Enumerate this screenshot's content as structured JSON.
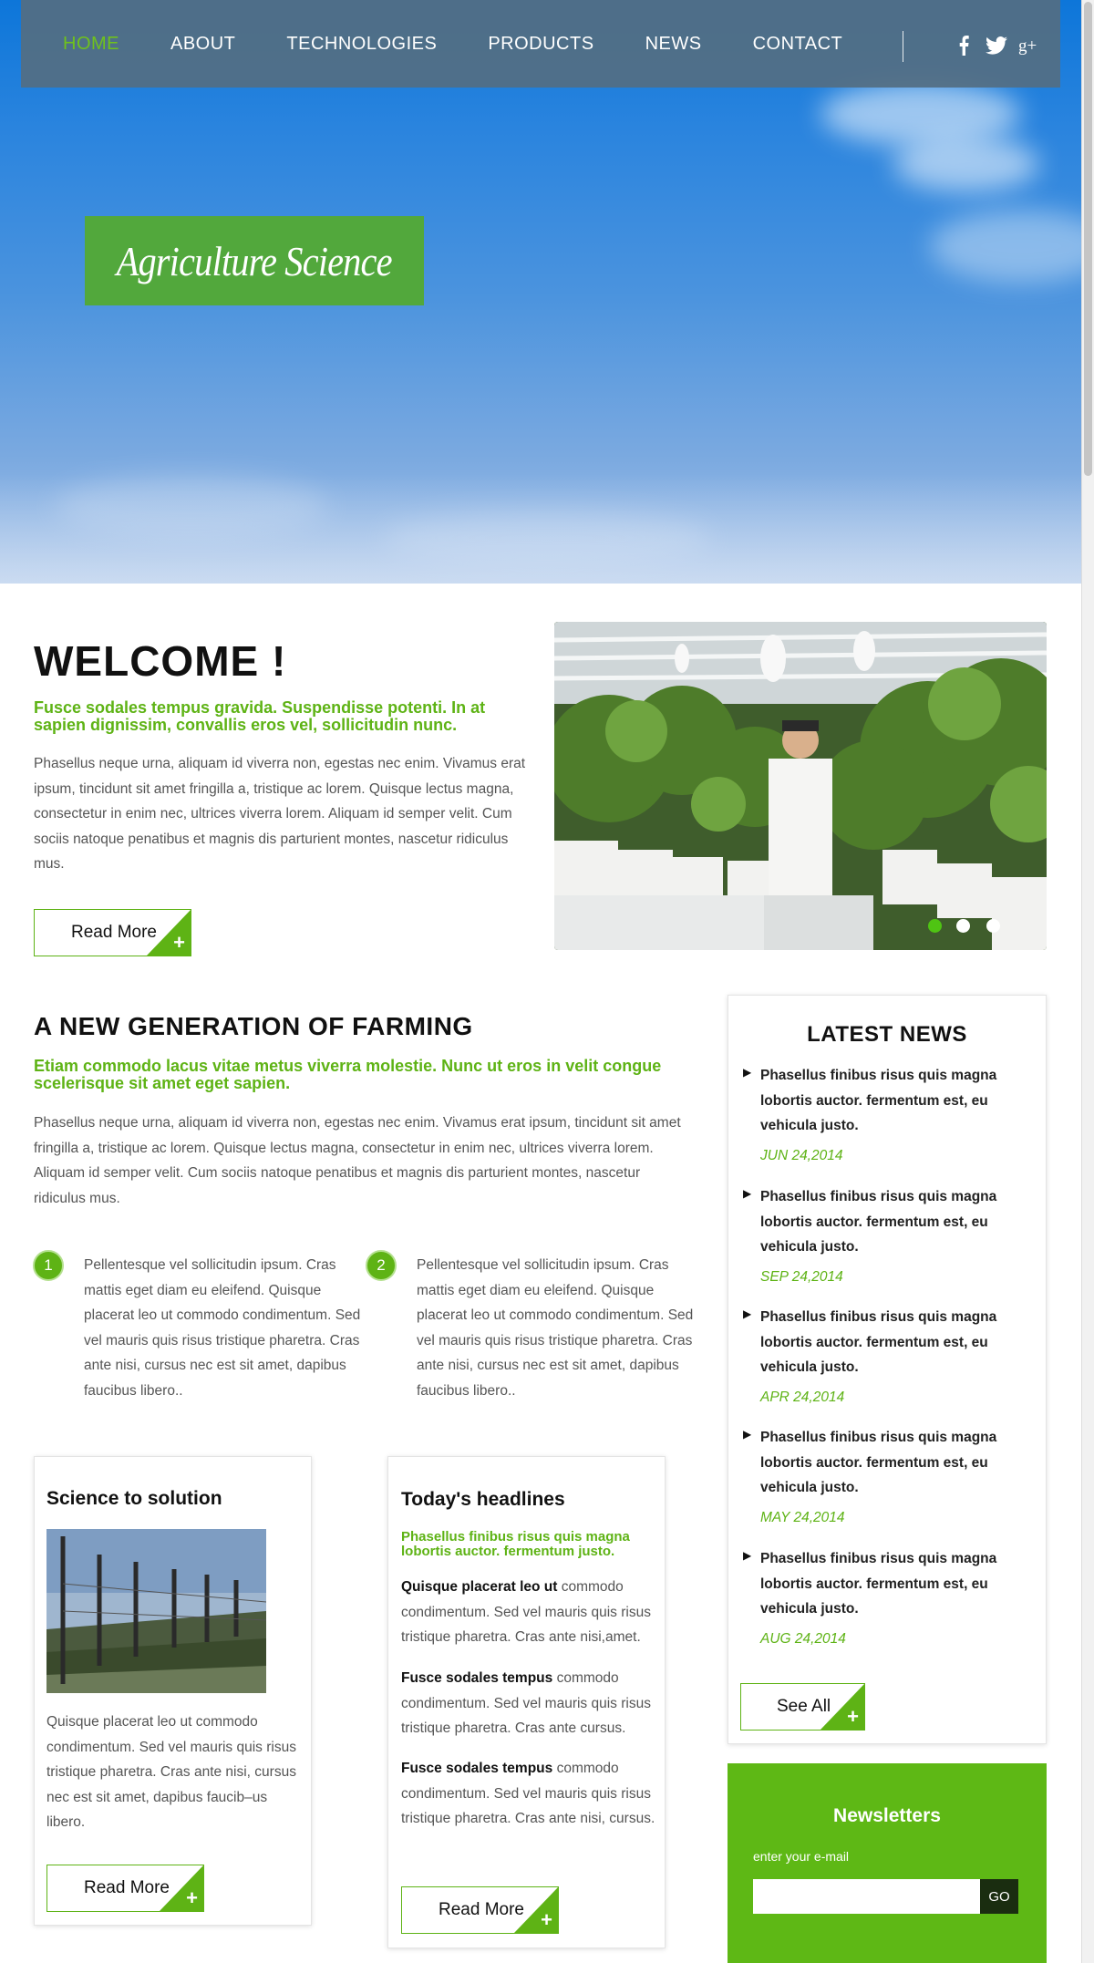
{
  "nav": {
    "items": [
      {
        "label": "HOME"
      },
      {
        "label": "ABOUT"
      },
      {
        "label": "TECHNOLOGIES"
      },
      {
        "label": "PRODUCTS"
      },
      {
        "label": "NEWS"
      },
      {
        "label": "CONTACT"
      }
    ],
    "active": "HOME",
    "social": [
      "facebook-icon",
      "twitter-icon",
      "google-plus-icon"
    ]
  },
  "hero": {
    "badge_text": "Agriculture Science"
  },
  "welcome": {
    "title": "WELCOME !",
    "lead": "Fusce sodales tempus gravida. Suspendisse potenti. In at sapien dignissim, convallis eros vel, sollicitudin nunc.",
    "body": "Phasellus neque urna, aliquam id viverra non, egestas nec enim. Vivamus erat ipsum, tincidunt sit amet fringilla a, tristique ac lorem. Quisque lectus magna, consectetur in enim nec, ultrices viverra lorem. Aliquam id semper velit. Cum sociis natoque penatibus et magnis dis parturient montes, nascetur ridiculus mus.",
    "button_label": "Read More"
  },
  "slider": {
    "dots": 3,
    "active_dot": 1
  },
  "farming": {
    "title": "A NEW GENERATION OF FARMING",
    "lead": "Etiam commodo lacus vitae metus viverra molestie. Nunc ut eros in velit congue scelerisque sit amet eget sapien.",
    "body": "Phasellus neque urna, aliquam id viverra non, egestas nec enim. Vivamus erat ipsum, tincidunt sit amet fringilla a, tristique ac lorem. Quisque lectus magna, consectetur in enim nec, ultrices viverra lorem. Aliquam id semper velit. Cum sociis natoque penatibus et magnis dis parturient montes, nascetur ridiculus mus.",
    "points": [
      {
        "number": "1",
        "text": "Pellentesque vel sollicitudin ipsum. Cras mattis eget diam eu eleifend. Quisque placerat leo ut commodo condimentum. Sed vel mauris quis risus tristique pharetra. Cras ante nisi, cursus nec est sit amet, dapibus faucibus libero.."
      },
      {
        "number": "2",
        "text": "Pellentesque vel sollicitudin ipsum. Cras mattis eget diam eu eleifend. Quisque placerat leo ut commodo condimentum. Sed vel mauris quis risus tristique pharetra. Cras ante nisi, cursus nec est sit amet, dapibus faucibus libero.."
      }
    ]
  },
  "science_card": {
    "title": "Science to solution",
    "body": "Quisque placerat leo ut commodo condimentum. Sed vel mauris quis risus tristique pharetra. Cras ante nisi, cursus nec est sit amet, dapibus faucib–us libero.",
    "button_label": "Read More"
  },
  "headlines_card": {
    "title": "Today's headlines",
    "lead": "Phasellus finibus risus quis magna lobortis auctor. fermentum justo.",
    "items": [
      {
        "bold": "Quisque placerat leo ut",
        "text": " commodo condimentum. Sed vel mauris quis risus tristique pharetra. Cras ante nisi,amet."
      },
      {
        "bold": "Fusce sodales tempus",
        "text": " commodo condimentum. Sed vel mauris quis risus tristique pharetra. Cras ante cursus."
      },
      {
        "bold": "Fusce sodales tempus",
        "text": " commodo condimentum. Sed vel mauris quis risus tristique pharetra. Cras ante nisi, cursus."
      }
    ],
    "button_label": "Read More"
  },
  "latest_news": {
    "title": "LATEST NEWS",
    "items": [
      {
        "text": "Phasellus finibus risus quis magna lobortis auctor. fermentum est, eu vehicula justo.",
        "date": "JUN 24,2014"
      },
      {
        "text": "Phasellus finibus risus quis magna lobortis auctor. fermentum est, eu vehicula justo.",
        "date": "SEP 24,2014"
      },
      {
        "text": "Phasellus finibus risus quis magna lobortis auctor. fermentum est, eu vehicula justo.",
        "date": "APR 24,2014"
      },
      {
        "text": "Phasellus finibus risus quis magna lobortis auctor. fermentum est, eu vehicula justo.",
        "date": "MAY 24,2014"
      },
      {
        "text": "Phasellus finibus risus quis magna lobortis auctor. fermentum est, eu vehicula justo.",
        "date": "AUG 24,2014"
      }
    ],
    "button_label": "See All"
  },
  "newsletter": {
    "title": "Newsletters",
    "label": "enter your e-mail",
    "input_value": "",
    "button_label": "GO"
  },
  "colors": {
    "accent_green": "#5eb315",
    "nav_bg": "#546e82",
    "hero_badge": "#52a83c",
    "newsletter_bg": "#5eb815"
  }
}
